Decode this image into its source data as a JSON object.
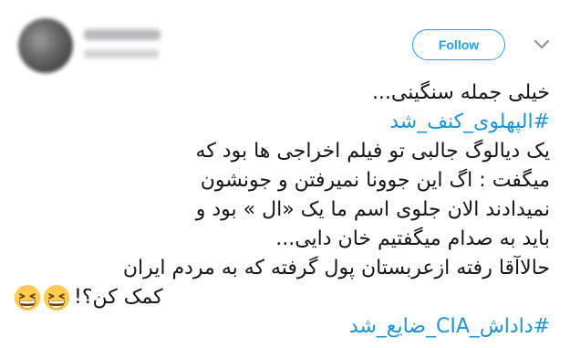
{
  "header": {
    "follow_label": "Follow"
  },
  "tweet": {
    "lines": [
      "خیلی جمله سنگینی...",
      "#الپهلوی_کنف_شد",
      "یک دیالوگ جالبی تو فیلم اخراجی ها بود که",
      "میگفت : اگ این جوونا نمیرفتن و جونشون",
      "نمیدادند الان جلوی اسم ما یک «ال » بود و",
      "باید به صدام میگفتیم خان دایی...",
      "حالاآقا رفته ازعربستان پول گرفته که به مردم ایران",
      "کمک کن؟!",
      "#داداش_CIA_ضایع_شد"
    ],
    "emoji_name": "grinning-squinting-face-emoji",
    "emoji_count": 2
  },
  "colors": {
    "link": "#1b95e0",
    "follow": "#1da1f2",
    "text": "#14171a",
    "emoji_face": "#ffcc4d"
  }
}
